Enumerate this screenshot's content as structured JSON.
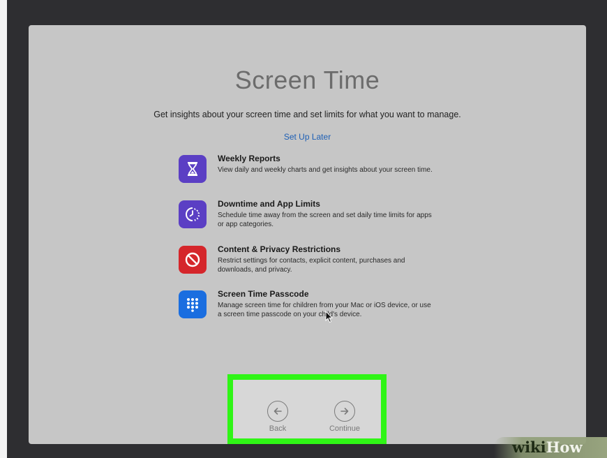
{
  "screen": {
    "title": "Screen Time",
    "subtitle": "Get insights about your screen time and set limits for what you want to manage.",
    "setup_later": "Set Up Later"
  },
  "features": [
    {
      "icon": "hourglass-icon",
      "color": "#5b3fc4",
      "title": "Weekly Reports",
      "description": "View daily and weekly charts and get insights about your screen time."
    },
    {
      "icon": "downtime-icon",
      "color": "#5b3fc4",
      "title": "Downtime and App Limits",
      "description": "Schedule time away from the screen and set daily time limits for apps or app categories."
    },
    {
      "icon": "no-entry-icon",
      "color": "#d5262b",
      "title": "Content & Privacy Restrictions",
      "description": "Restrict settings for contacts, explicit content, purchases and downloads, and privacy."
    },
    {
      "icon": "keypad-icon",
      "color": "#1a6ee0",
      "title": "Screen Time Passcode",
      "description": "Manage screen time for children from your Mac or iOS device, or use a screen time passcode on your child's device."
    }
  ],
  "nav": {
    "back_label": "Back",
    "continue_label": "Continue"
  },
  "highlight_color": "#2ff516",
  "watermark": {
    "part1": "wiki",
    "part2": "How"
  }
}
